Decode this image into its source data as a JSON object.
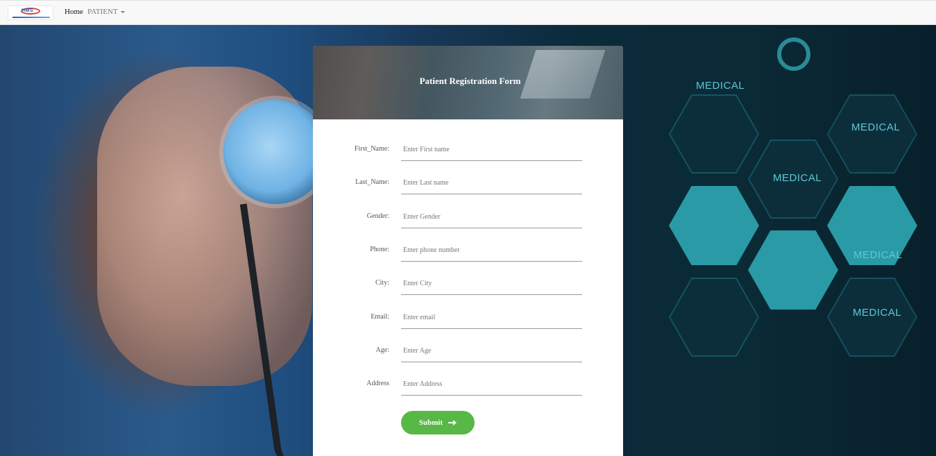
{
  "navbar": {
    "logo_text": "HMS",
    "home_label": "Home",
    "patient_label": "PATIENT"
  },
  "background": {
    "labels": [
      "MEDICAL",
      "MEDICAL",
      "MEDICAL",
      "MEDICAL",
      "MEDICAL"
    ]
  },
  "form": {
    "title": "Patient Registration Form",
    "fields": [
      {
        "label": "First_Name:",
        "placeholder": "Enter First name"
      },
      {
        "label": "Last_Name:",
        "placeholder": "Enter Last name"
      },
      {
        "label": "Gender:",
        "placeholder": "Enter Gender"
      },
      {
        "label": "Phone:",
        "placeholder": "Enter phone number"
      },
      {
        "label": "City:",
        "placeholder": "Enter City"
      },
      {
        "label": "Email:",
        "placeholder": "Enter email"
      },
      {
        "label": "Age:",
        "placeholder": "Enter Age"
      },
      {
        "label": "Address",
        "placeholder": "Enter Address"
      }
    ],
    "submit_label": "Submit",
    "submit_icon": "arrow-right-icon"
  },
  "colors": {
    "submit": "#57b846",
    "navbar_bg": "#f8f8f8",
    "accent_teal": "#2a9aa6"
  }
}
